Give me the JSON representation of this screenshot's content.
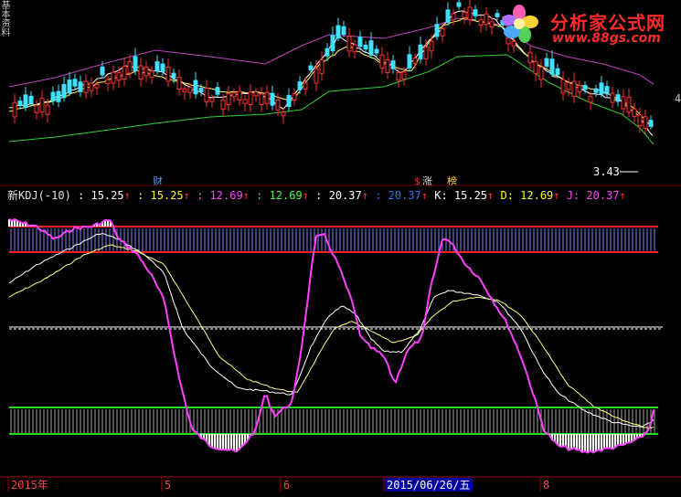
{
  "side_tab": {
    "text": "基本资料"
  },
  "logo": {
    "title": "分析家公式网",
    "url": "www.88gs.com"
  },
  "price_panel": {
    "price_marker": "3.43",
    "right_edge_label": "4",
    "event_labels": [
      {
        "text": "财",
        "color": "#4aa0ff"
      },
      {
        "text": "$",
        "color": "#ff3030"
      },
      {
        "text": "涨",
        "color": "#e0e0e0"
      },
      {
        "text": "榜",
        "color": "#ffd040"
      }
    ]
  },
  "indicator_header": {
    "name": "新KDJ(-10)",
    "items": [
      {
        "text": ": 15.25",
        "color": "#ffffff",
        "arrow": "↑"
      },
      {
        "text": ": 15.25",
        "color": "#ffff00",
        "arrow": "↑"
      },
      {
        "text": ": 12.69",
        "color": "#ff40ff",
        "arrow": "↑"
      },
      {
        "text": ": 12.69",
        "color": "#40ff40",
        "arrow": "↑"
      },
      {
        "text": ": 20.37",
        "color": "#ffffff",
        "arrow": "↑"
      },
      {
        "text": ": 20.37",
        "color": "#3070ff",
        "arrow": "↑"
      },
      {
        "text": "K: 15.25",
        "color": "#ffffff",
        "arrow": "↑"
      },
      {
        "text": "D: 12.69",
        "color": "#ffff00",
        "arrow": "↑"
      },
      {
        "text": "J: 20.37",
        "color": "#ff40ff",
        "arrow": "↑"
      }
    ],
    "arrow_color": "#ff3030"
  },
  "date_axis": {
    "labels": [
      "2015年",
      "5",
      "6",
      "2015/06/26/五",
      "8"
    ],
    "selected": "2015/06/26/五"
  },
  "colors": {
    "up": "#ff3030",
    "down": "#40e0ff",
    "ma_white": "#ffffff",
    "ma_yellow": "#ffff60",
    "band_upper": "#c040c0",
    "band_lower": "#30d030",
    "k_line": "#ffffff",
    "d_line": "#ffff80",
    "j_line": "#ff40ff",
    "upper_zone": "#ff2020",
    "lower_zone": "#20e020",
    "zero_line": "#ffffff"
  },
  "chart_data": {
    "type": "line",
    "series": [
      {
        "name": "K",
        "last": 15.25
      },
      {
        "name": "D",
        "last": 12.69
      },
      {
        "name": "J",
        "last": 20.37
      }
    ]
  }
}
